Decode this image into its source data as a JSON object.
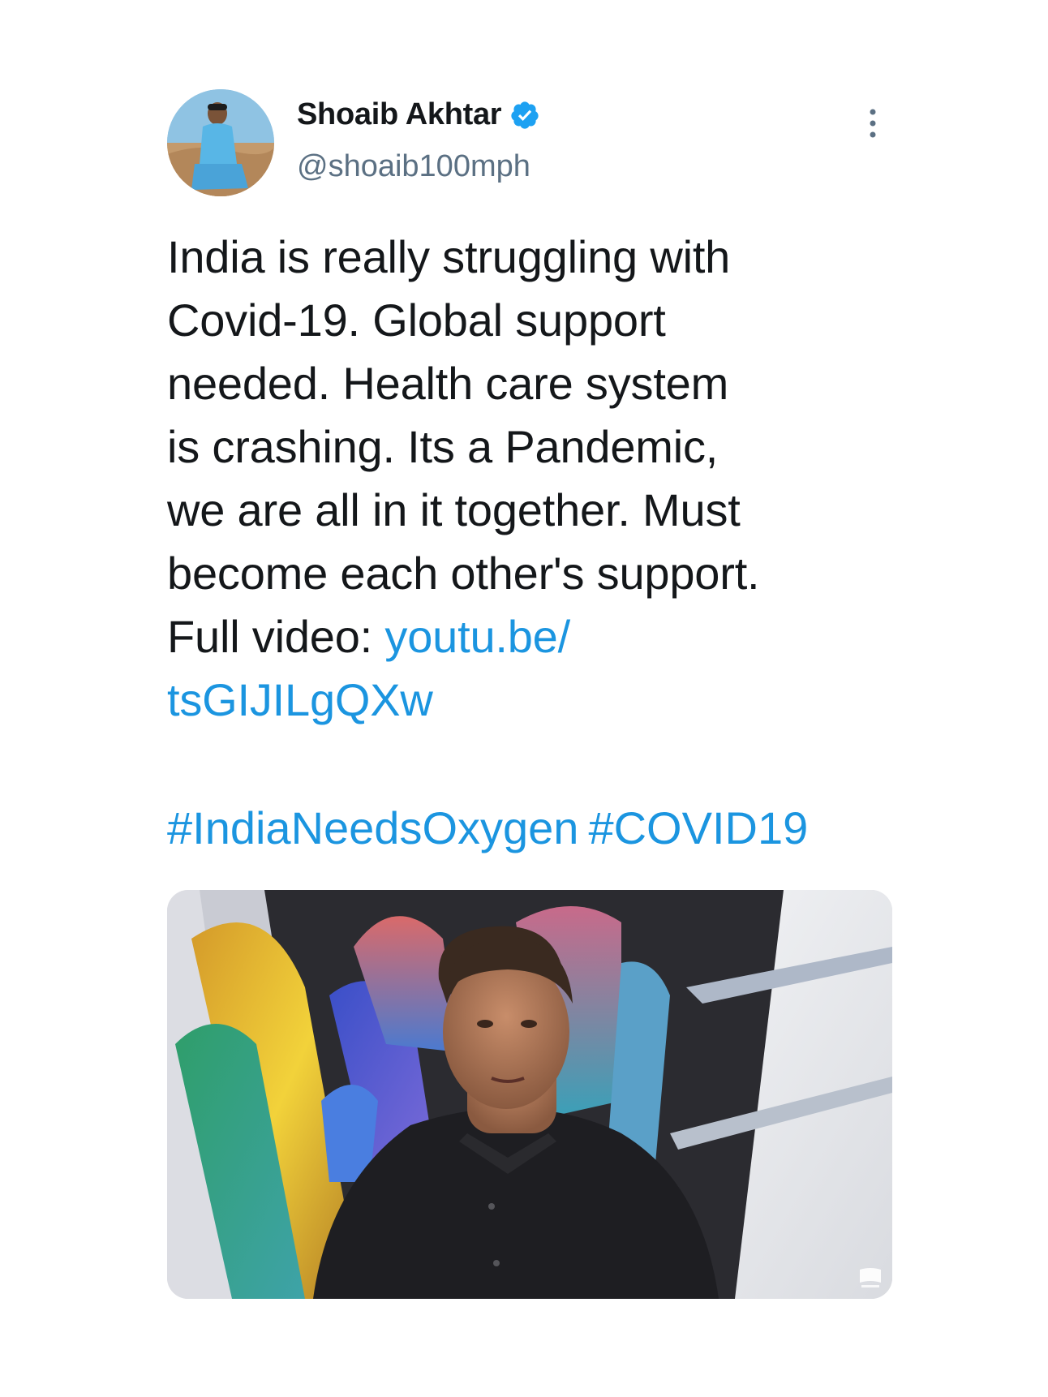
{
  "author": {
    "display_name": "Shoaib Akhtar",
    "handle": "@shoaib100mph",
    "verified": true
  },
  "tweet": {
    "lines": [
      "India is really struggling with",
      "Covid-19. Global support",
      "needed. Health care system",
      "is crashing. Its a Pandemic,",
      "we are all in it together. Must",
      "become each other's support."
    ],
    "full_video_prefix": "Full video: ",
    "link_part1": "youtu.be/",
    "link_part2": "tsGIJILgQXw",
    "hashtags": [
      "#IndiaNeedsOxygen",
      "#COVID19"
    ]
  },
  "media": {
    "type": "video",
    "description_icon": "video-badge-icon"
  },
  "colors": {
    "link": "#1b95e0",
    "verified": "#1da1f2",
    "handle": "#5b7083",
    "text": "#14171a"
  },
  "icons": {
    "verified": "verified-badge-icon",
    "more": "more-vertical-icon"
  }
}
